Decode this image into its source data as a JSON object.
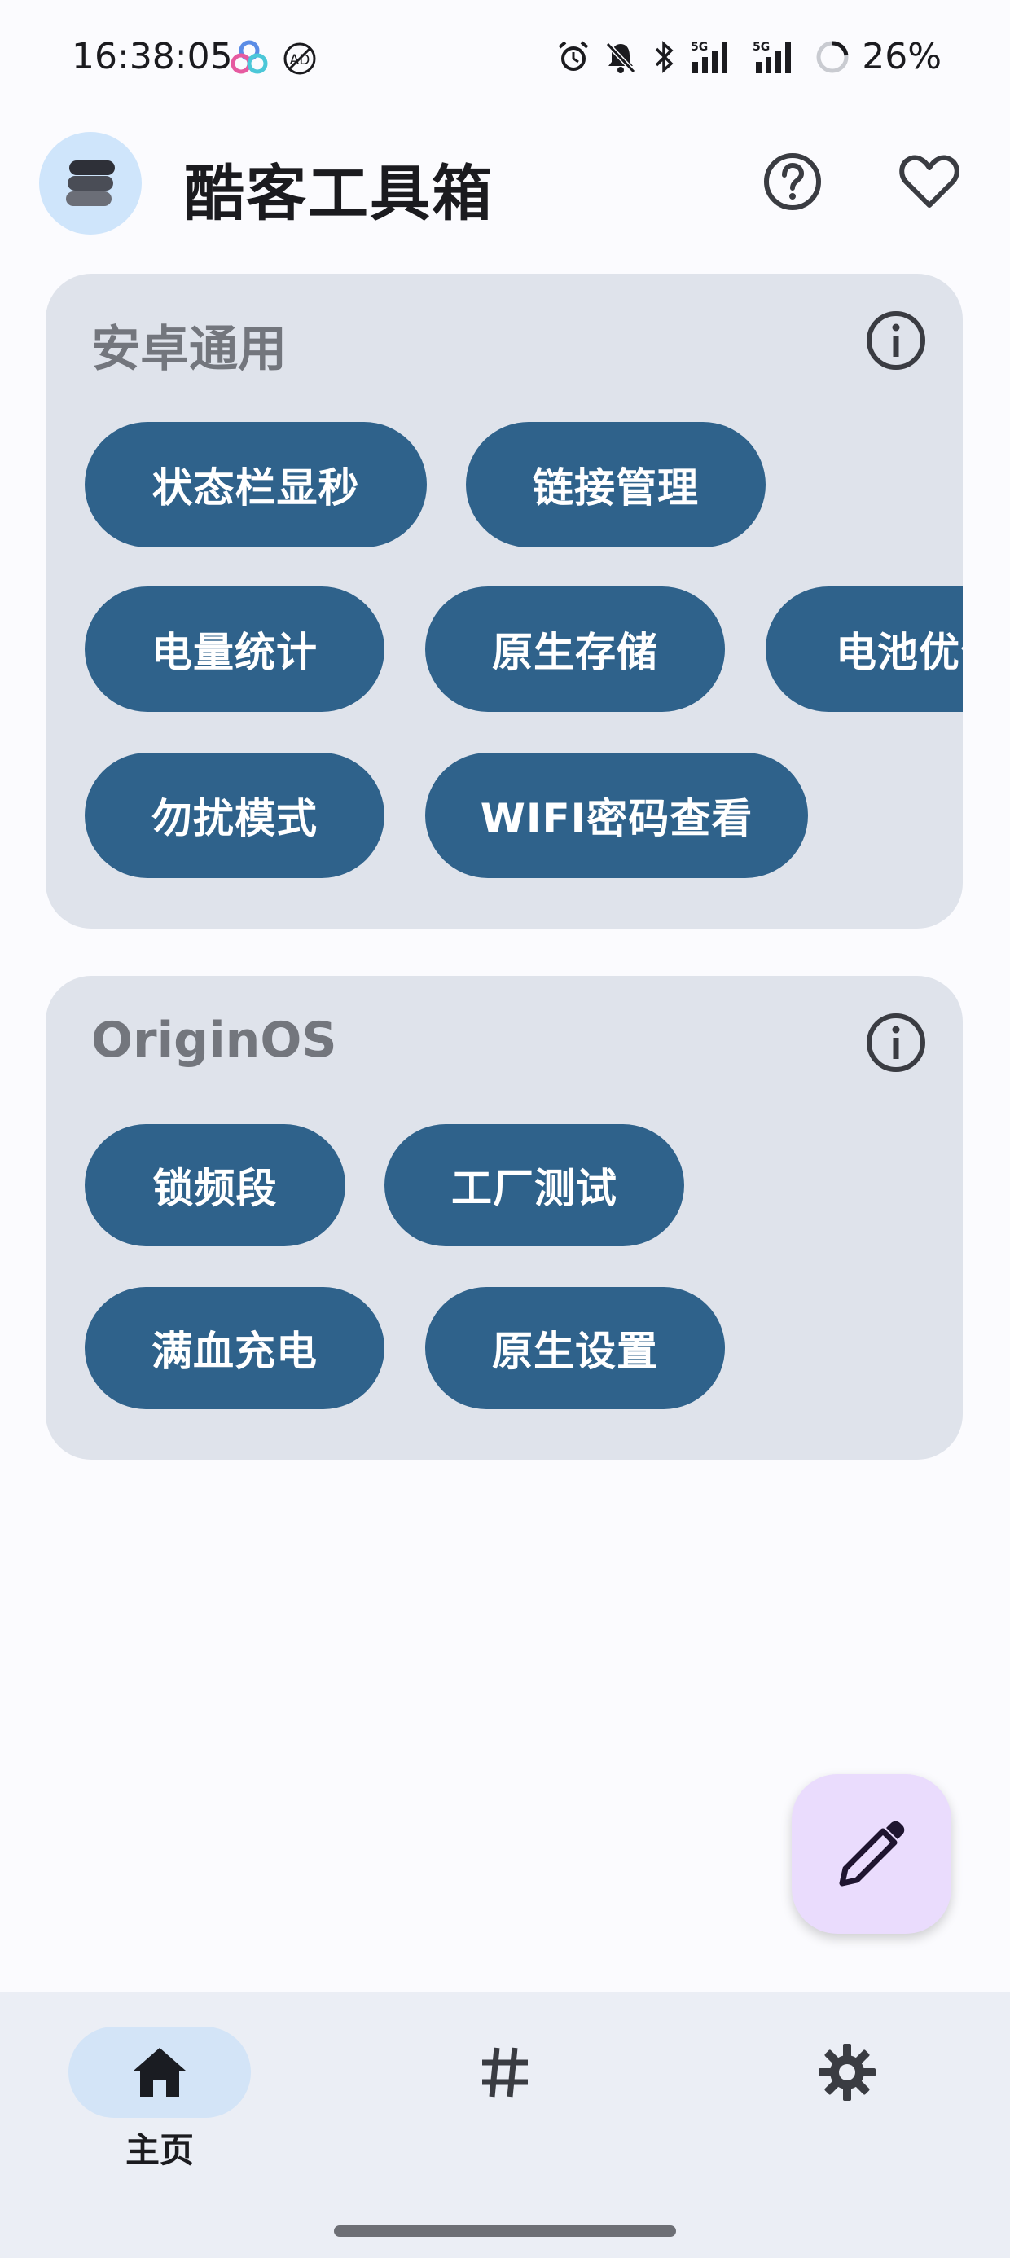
{
  "status_bar": {
    "time": "16:38:05",
    "battery": "26%",
    "network": "5G"
  },
  "header": {
    "title": "酷客工具箱"
  },
  "sections": [
    {
      "title": "安卓通用",
      "chips": [
        "状态栏显秒",
        "链接管理",
        "电量统计",
        "原生存储",
        "电池优化",
        "勿扰模式",
        "WIFI密码查看"
      ]
    },
    {
      "title": "OriginOS",
      "chips": [
        "锁频段",
        "工厂测试",
        "满血充电",
        "原生设置"
      ]
    }
  ],
  "nav": {
    "items": [
      {
        "label": "主页",
        "icon": "home-icon",
        "active": true
      },
      {
        "label": "",
        "icon": "tag-icon",
        "active": false
      },
      {
        "label": "",
        "icon": "gear-icon",
        "active": false
      }
    ]
  },
  "colors": {
    "chip_bg": "#2f628b",
    "card_bg": "#dfe3eb",
    "fab_bg": "#eadcfd",
    "nav_active_bg": "#d3e4f7"
  }
}
